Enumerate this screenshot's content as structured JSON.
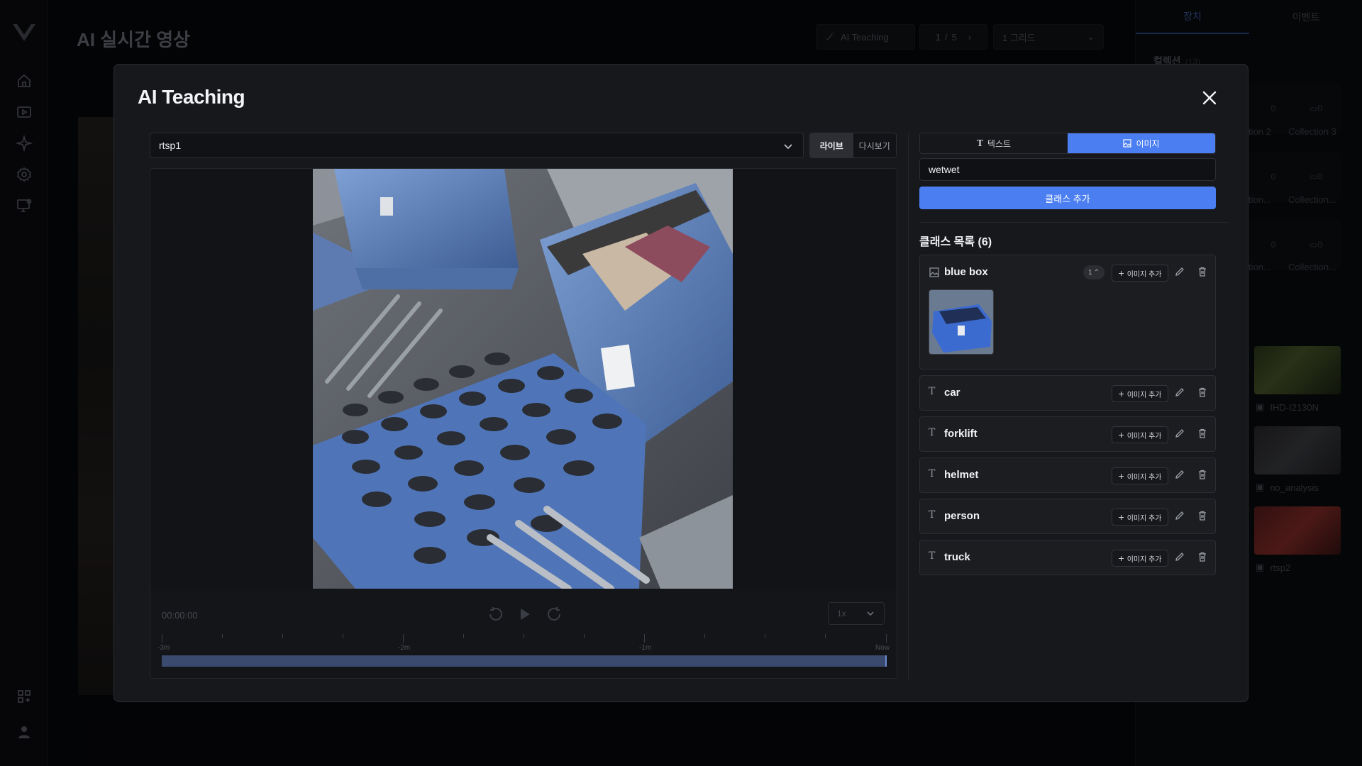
{
  "background": {
    "page_title": "AI 실시간 영상",
    "top_bar": {
      "ai_teaching_label": "AI Teaching",
      "page_current": "1",
      "page_sep": "/",
      "page_total": "5",
      "grid_select": "1 그리드"
    },
    "right_panel": {
      "tabs": [
        "장치",
        "이벤트"
      ],
      "section_title": "컬렉션",
      "section_count": "(13)",
      "collections": [
        {
          "label": "tion 2",
          "count": "0"
        },
        {
          "label": "Collection 3",
          "count": "0"
        },
        {
          "label": "tion...",
          "count": "0"
        },
        {
          "label": "Collection...",
          "count": "0"
        },
        {
          "label": "tion...",
          "count": "0"
        },
        {
          "label": "Collection...",
          "count": "0"
        }
      ],
      "cameras": [
        "IHD-I2130N",
        "no_analysis",
        "rtsp2"
      ]
    }
  },
  "modal": {
    "title": "AI Teaching",
    "stream_select": "rtsp1",
    "mode_tabs": {
      "live": "라이브",
      "replay": "다시보기",
      "active": "live"
    },
    "player": {
      "time": "00:00:00",
      "speed": "1x",
      "timeline_labels": [
        "-3m",
        "-2m",
        "-1m",
        "Now"
      ]
    },
    "type_tabs": {
      "text": "텍스트",
      "image": "이미지",
      "active": "image"
    },
    "class_input_value": "wetwet",
    "add_class_button": "클래스 추가",
    "class_list_title": "클래스 목록 (6)",
    "add_image_label": "이미지 추가",
    "classes": [
      {
        "name": "blue box",
        "type": "image",
        "count": "1"
      },
      {
        "name": "car",
        "type": "text"
      },
      {
        "name": "forklift",
        "type": "text"
      },
      {
        "name": "helmet",
        "type": "text"
      },
      {
        "name": "person",
        "type": "text"
      },
      {
        "name": "truck",
        "type": "text"
      }
    ],
    "colors": {
      "accent": "#4a7ef1",
      "modal_bg": "#17181c",
      "card_bg": "#1c1d21"
    }
  }
}
